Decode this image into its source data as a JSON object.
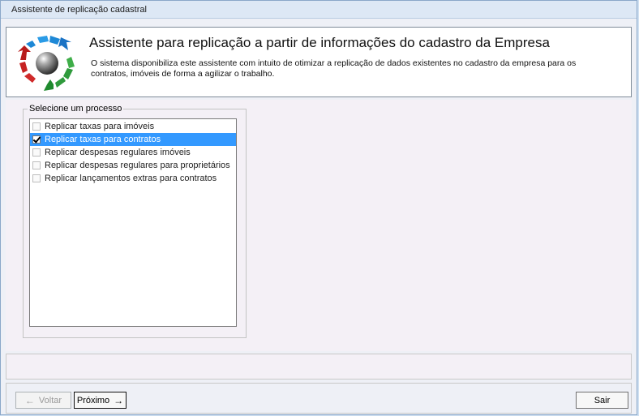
{
  "window": {
    "title": "Assistente de replicação cadastral"
  },
  "header": {
    "title": "Assistente para replicação a partir de informações do cadastro da Empresa",
    "description": "O sistema disponibiliza este assistente com intuito de otimizar a replicação de dados existentes no cadastro da empresa para os contratos, imóveis de forma a agilizar o trabalho."
  },
  "process_group": {
    "legend": "Selecione um processo",
    "items": [
      {
        "label": "Replicar taxas para imóveis",
        "checked": false,
        "selected": false
      },
      {
        "label": "Replicar taxas para contratos",
        "checked": true,
        "selected": true
      },
      {
        "label": "Replicar despesas regulares imóveis",
        "checked": false,
        "selected": false
      },
      {
        "label": "Replicar despesas regulares para proprietários",
        "checked": false,
        "selected": false
      },
      {
        "label": "Replicar lançamentos extras para contratos",
        "checked": false,
        "selected": false
      }
    ]
  },
  "footer": {
    "back_label": "Voltar",
    "back_icon": "arrow-left-icon",
    "next_label": "Próximo",
    "next_icon": "arrow-right-icon",
    "exit_label": "Sair"
  }
}
